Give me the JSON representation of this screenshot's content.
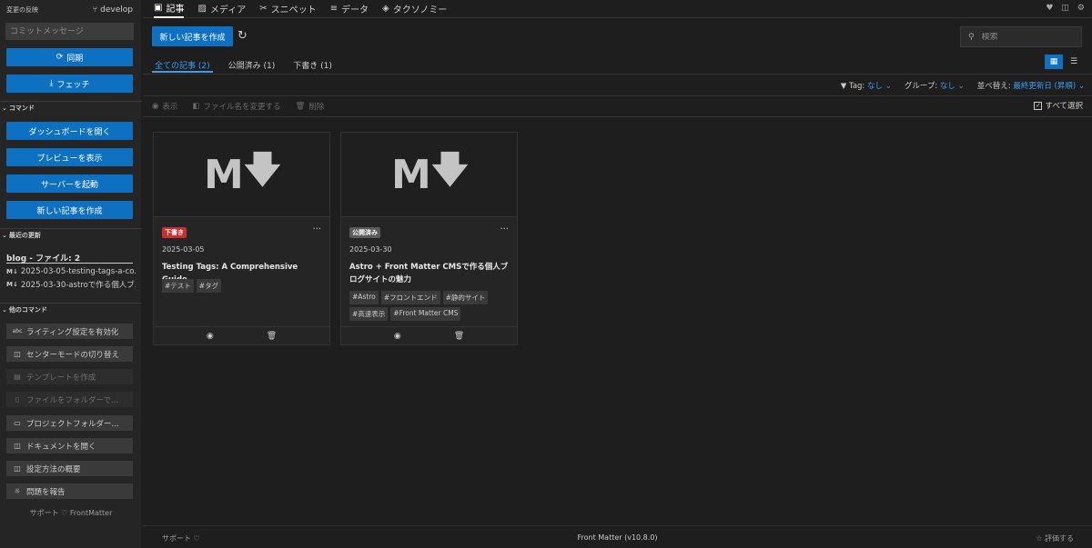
{
  "sidebar": {
    "changes_title": "変更の反映",
    "branch": "develop",
    "commit_placeholder": "コミットメッセージ",
    "sync_label": "同期",
    "fetch_label": "フェッチ",
    "commands_header": "コマンド",
    "commands": [
      "ダッシュボードを開く",
      "プレビューを表示",
      "サーバーを起動",
      "新しい記事を作成"
    ],
    "recent_header": "最近の更新",
    "recent_title": "blog - ファイル: 2",
    "recent_items": [
      "2025-03-05-testing-tags-a-co...",
      "2025-03-30-astroで作る個人ブ..."
    ],
    "recent_icon": "M↓",
    "other_header": "他のコマンド",
    "other_commands": [
      {
        "label": "ライティング設定を有効化",
        "icon": "abc",
        "disabled": false
      },
      {
        "label": "センターモードの切り替え",
        "icon": "center-mode-icon",
        "disabled": false
      },
      {
        "label": "テンプレートを作成",
        "icon": "template-icon",
        "disabled": true
      },
      {
        "label": "ファイルをフォルダーで...",
        "icon": "file-icon",
        "disabled": true
      },
      {
        "label": "プロジェクトフォルダー...",
        "icon": "folder-icon",
        "disabled": false
      },
      {
        "label": "ドキュメントを開く",
        "icon": "book-icon",
        "disabled": false
      },
      {
        "label": "設定方法の概要",
        "icon": "book-icon",
        "disabled": false
      },
      {
        "label": "問題を報告",
        "icon": "bug-icon",
        "disabled": false
      }
    ],
    "support_text": "サポート",
    "support_brand": "FrontMatter"
  },
  "nav": {
    "tabs": [
      "記事",
      "メディア",
      "スニペット",
      "データ",
      "タクソノミー"
    ],
    "active_index": 0
  },
  "toolbar": {
    "new_article": "新しい記事を作成",
    "search_placeholder": "検索"
  },
  "filter_tabs": [
    {
      "label": "全ての記事 (2)",
      "active": true
    },
    {
      "label": "公開済み (1)",
      "active": false
    },
    {
      "label": "下書き (1)",
      "active": false
    }
  ],
  "filters": {
    "tag_label": "Tag:",
    "tag_value": "なし",
    "group_label": "グループ:",
    "group_value": "なし",
    "sort_label": "並べ替え:",
    "sort_value": "最終更新日 (昇順)"
  },
  "actions": {
    "view": "表示",
    "rename": "ファイル名を変更する",
    "delete": "削除",
    "select_all": "すべて選択"
  },
  "cards": [
    {
      "status": "下書き",
      "status_color": "#c72e2e",
      "date": "2025-03-05",
      "title": "Testing Tags: A Comprehensive Guide",
      "tags": [
        "#テスト",
        "#タグ"
      ]
    },
    {
      "status": "公開済み",
      "status_color": "#5a5a5a",
      "date": "2025-03-30",
      "title": "Astro + Front Matter CMSで作る個人ブログサイトの魅力",
      "tags": [
        "#Astro",
        "#フロントエンド",
        "#静的サイト",
        "#高速表示",
        "#Front Matter CMS"
      ]
    }
  ],
  "footer": {
    "support": "サポート",
    "version": "Front Matter (v10.8.0)",
    "rate": "評価する"
  },
  "colors": {
    "accent": "#0e70c0",
    "link": "#3e9cf0"
  }
}
